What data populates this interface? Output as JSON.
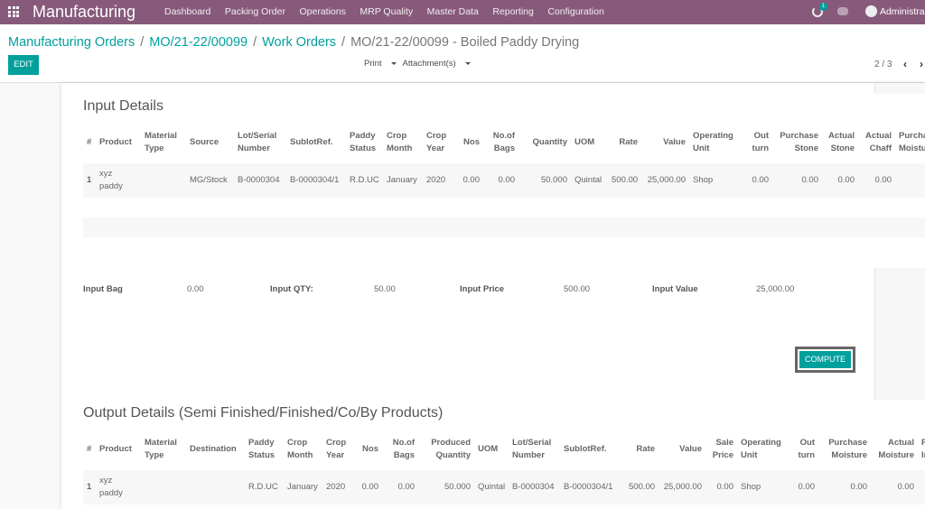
{
  "navbar": {
    "app_title": "Manufacturing",
    "menu": [
      "Dashboard",
      "Packing Order",
      "Operations",
      "MRP Quality",
      "Master Data",
      "Reporting",
      "Configuration"
    ],
    "activity_count": "1",
    "user": "Administra"
  },
  "breadcrumb": {
    "items": [
      "Manufacturing Orders",
      "MO/21-22/00099",
      "Work Orders"
    ],
    "current": "MO/21-22/00099 - Boiled Paddy Drying",
    "separator": "/"
  },
  "toolbar": {
    "edit_label": "EDIT",
    "print_label": "Print",
    "attachments_label": "Attachment(s)",
    "pager": "2 / 3",
    "prev_icon": "‹",
    "next_icon": "›"
  },
  "input_details": {
    "title": "Input Details",
    "columns": [
      "#",
      "Product",
      "Material Type",
      "Source",
      "Lot/Serial Number",
      "SublotRef.",
      "Paddy Status",
      "Crop Month",
      "Crop Year",
      "Nos",
      "No.of Bags",
      "Quantity",
      "UOM",
      "Rate",
      "Value",
      "Operating Unit",
      "Out turn",
      "Purchase Stone",
      "Actual Stone",
      "Actual Chaff",
      "Purcha Moistu"
    ],
    "rows": [
      [
        "1",
        "xyz paddy",
        "",
        "MG/Stock",
        "B-0000304",
        "B-0000304/1",
        "R.D.UC",
        "January",
        "2020",
        "0.00",
        "0.00",
        "50.000",
        "Quintal",
        "500.00",
        "25,000.00",
        "Shop",
        "0.00",
        "0.00",
        "0.00",
        "0.00",
        ""
      ]
    ]
  },
  "summary": {
    "input_bag_label": "Input Bag",
    "input_bag": "0.00",
    "input_qty_label": "Input QTY:",
    "input_qty": "50.00",
    "input_price_label": "Input Price",
    "input_price": "500.00",
    "input_value_label": "Input Value",
    "input_value": "25,000.00",
    "compute_label": "COMPUTE"
  },
  "output_details": {
    "title": "Output Details (Semi Finished/Finished/Co/By Products)",
    "columns": [
      "#",
      "Product",
      "Material Type",
      "Destination",
      "Paddy Status",
      "Crop Month",
      "Crop Year",
      "Nos",
      "No.of Bags",
      "Produced Quantity",
      "UOM",
      "Lot/Serial Number",
      "SublotRef.",
      "Rate",
      "Value",
      "Sale Price",
      "Operating Unit",
      "Out turn",
      "Purchase Moisture",
      "Actual Moisture",
      "P In"
    ],
    "rows": [
      [
        "1",
        "xyz paddy",
        "",
        "",
        "R.D.UC",
        "January",
        "2020",
        "0.00",
        "0.00",
        "50.000",
        "Quintal",
        "B-0000304",
        "B-0000304/1",
        "500.00",
        "25,000.00",
        "0.00",
        "Shop",
        "0.00",
        "0.00",
        "0.00",
        ""
      ]
    ]
  },
  "colors": {
    "navbar": "#875a7b",
    "accent": "#00a09d"
  }
}
